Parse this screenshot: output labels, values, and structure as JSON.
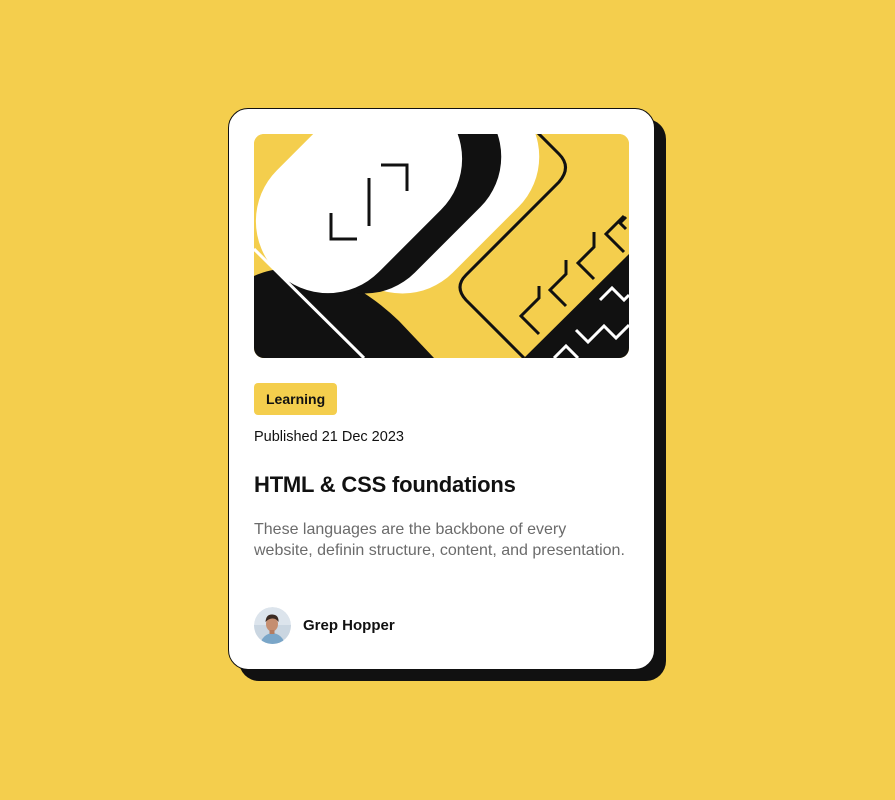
{
  "colors": {
    "page_background": "#F4CE4D",
    "card_background": "#FFFFFF",
    "ink": "#111111",
    "muted_text": "#6B6B6B"
  },
  "card": {
    "illustration": "abstract-code-illustration",
    "category": "Learning",
    "published": "Published 21 Dec 2023",
    "title": "HTML & CSS foundations",
    "description": "These languages are the backbone of every website, definin structure, content, and presentation.",
    "author": {
      "avatar": "author-avatar",
      "name": "Grep Hopper"
    }
  }
}
